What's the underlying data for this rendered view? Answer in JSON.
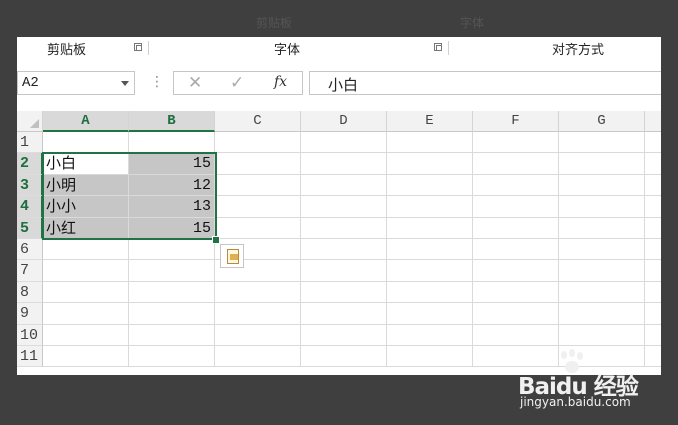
{
  "ribbon": {
    "groups": [
      {
        "label": "剪贴板"
      },
      {
        "label": "字体"
      },
      {
        "label": "对齐方式"
      }
    ]
  },
  "formula_bar": {
    "name_box": "A2",
    "cancel_icon": "✕",
    "enter_icon": "✓",
    "fx_label": "fx",
    "content": "小白"
  },
  "sheet": {
    "columns": [
      "A",
      "B",
      "C",
      "D",
      "E",
      "F",
      "G"
    ],
    "row_numbers": [
      "1",
      "2",
      "3",
      "4",
      "5",
      "6",
      "7",
      "8",
      "9",
      "10",
      "11"
    ],
    "rows": [
      [
        "",
        ""
      ],
      [
        "小白",
        "15"
      ],
      [
        "小明",
        "12"
      ],
      [
        "小小",
        "13"
      ],
      [
        "小红",
        "15"
      ]
    ],
    "active_cell": "A2",
    "selection": "A2:B5",
    "selection_color": "#217346"
  },
  "watermark": {
    "brand": "Baidu 经验",
    "url": "jingyan.baidu.com"
  }
}
